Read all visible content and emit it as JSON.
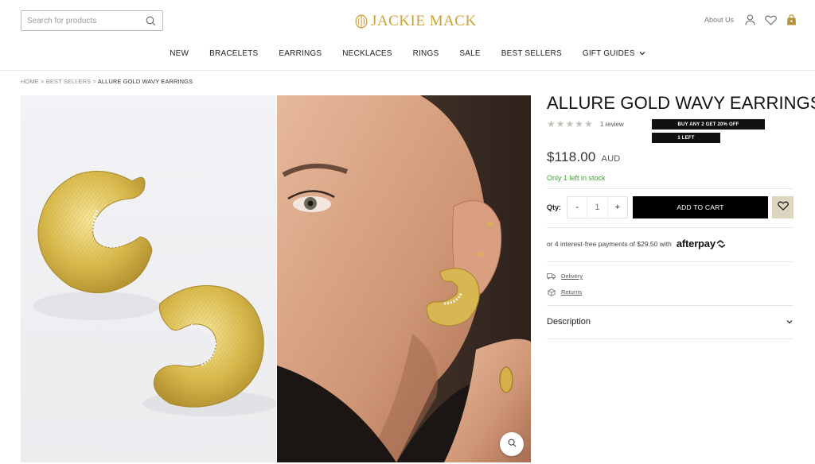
{
  "header": {
    "search": {
      "placeholder": "Search for products",
      "value": ""
    },
    "logo_text": "JACKIE MACK",
    "about_label": "About Us",
    "brand_color": "#c9a337"
  },
  "nav": {
    "items": [
      {
        "label": "NEW"
      },
      {
        "label": "BRACELETS"
      },
      {
        "label": "EARRINGS"
      },
      {
        "label": "NECKLACES"
      },
      {
        "label": "RINGS"
      },
      {
        "label": "SALE"
      },
      {
        "label": "BEST SELLERS"
      },
      {
        "label": "GIFT GUIDES"
      }
    ]
  },
  "breadcrumb": {
    "home": "HOME",
    "sep": ">",
    "section": "BEST SELLERS",
    "current": "ALLURE GOLD WAVY EARRINGS"
  },
  "product": {
    "title": "ALLURE GOLD WAVY EARRINGS",
    "rating_stars": 5,
    "review_count": "1 review",
    "promo_badge": "BUY ANY 2 GET 20% OFF",
    "stock_badge": "1 LEFT",
    "price": "$118.00",
    "currency": "AUD",
    "stock_text": "Only 1 left in stock",
    "stock_color": "#3f9f34",
    "qty_label": "Qty:",
    "qty_minus": "-",
    "qty_value": "1",
    "qty_plus": "+",
    "add_to_cart": "ADD TO CART",
    "afterpay_text": "or 4 interest-free payments of $29.50 with",
    "afterpay_brand": "afterpay",
    "delivery_label": "Delivery",
    "returns_label": "Returns",
    "description_label": "Description"
  }
}
